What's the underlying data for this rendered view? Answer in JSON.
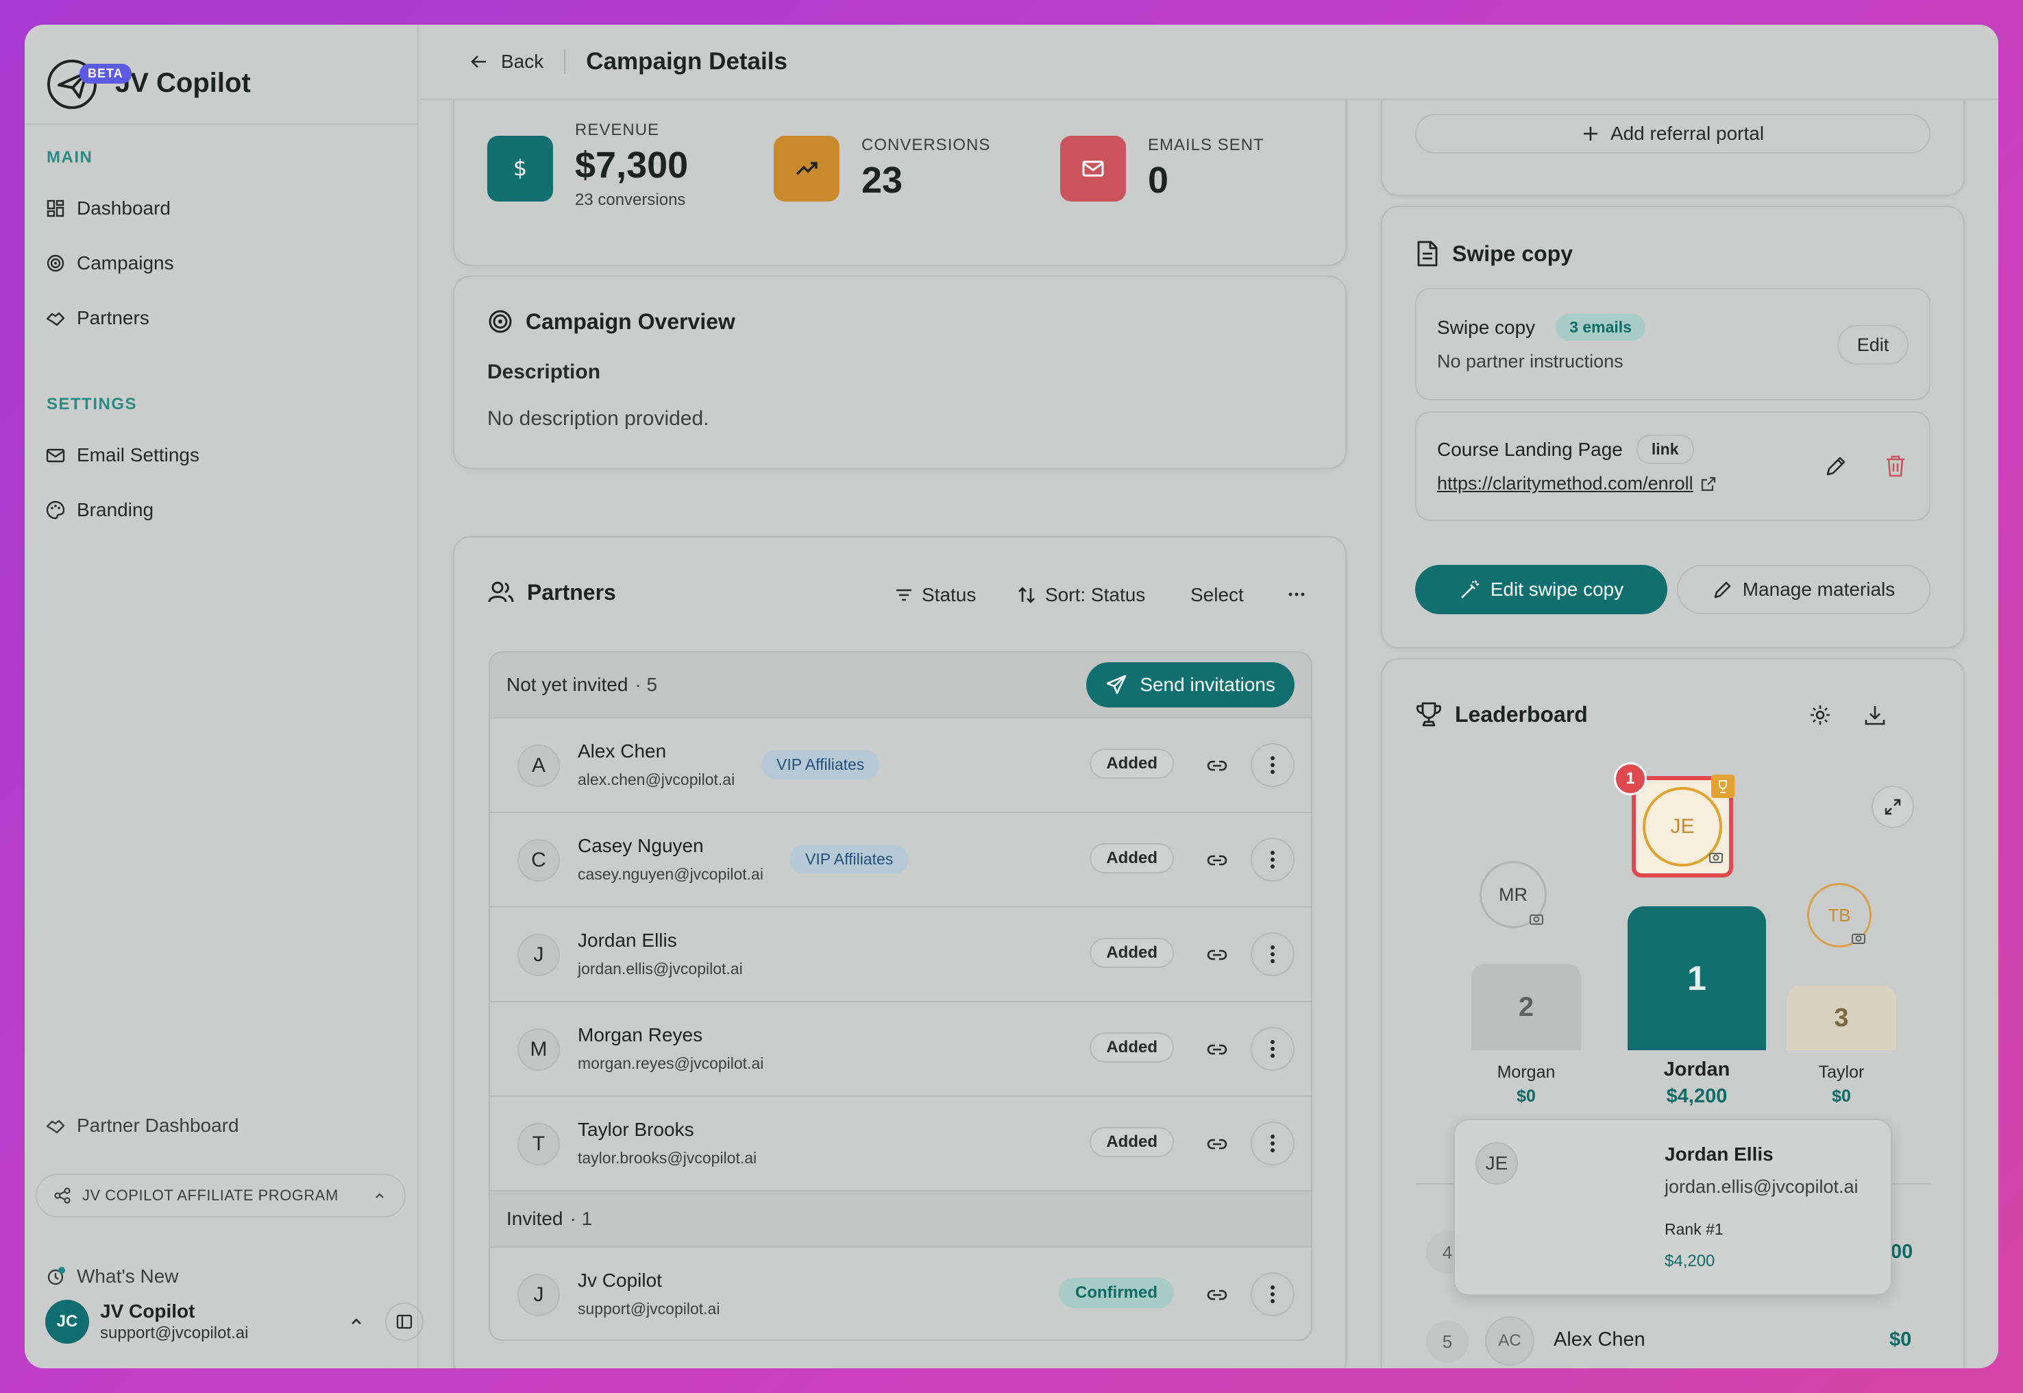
{
  "app": {
    "name": "JV Copilot",
    "beta_label": "BETA"
  },
  "sidebar": {
    "main_label": "MAIN",
    "main_items": [
      {
        "label": "Dashboard",
        "icon": "dashboard-icon"
      },
      {
        "label": "Campaigns",
        "icon": "target-icon"
      },
      {
        "label": "Partners",
        "icon": "handshake-icon"
      }
    ],
    "settings_label": "SETTINGS",
    "settings_items": [
      {
        "label": "Email Settings",
        "icon": "mail-icon"
      },
      {
        "label": "Branding",
        "icon": "palette-icon"
      }
    ],
    "partner_dashboard": "Partner Dashboard",
    "program": "JV COPILOT AFFILIATE PROGRAM",
    "whats_new": "What's New",
    "user": {
      "initials": "JC",
      "name": "JV Copilot",
      "email": "support@jvcopilot.ai"
    }
  },
  "header": {
    "back_label": "Back",
    "title": "Campaign Details"
  },
  "stats": [
    {
      "label": "REVENUE",
      "value": "$7,300",
      "sub": "23 conversions",
      "icon": "dollar-icon",
      "color": "#11706f"
    },
    {
      "label": "CONVERSIONS",
      "value": "23",
      "icon": "trending-up-icon",
      "color": "#c98a2e"
    },
    {
      "label": "EMAILS SENT",
      "value": "0",
      "icon": "mail-icon",
      "color": "#c9545c"
    }
  ],
  "overview": {
    "title": "Campaign Overview",
    "desc_label": "Description",
    "desc_text": "No description provided."
  },
  "partners": {
    "title": "Partners",
    "status_btn": "Status",
    "sort_btn": "Sort: Status",
    "select_btn": "Select",
    "group1": {
      "label": "Not yet invited",
      "count": "· 5",
      "action": "Send invitations"
    },
    "rows": [
      {
        "initial": "A",
        "name": "Alex Chen",
        "email": "alex.chen@jvcopilot.ai",
        "tag": "VIP Affiliates",
        "status": "Added"
      },
      {
        "initial": "C",
        "name": "Casey Nguyen",
        "email": "casey.nguyen@jvcopilot.ai",
        "tag": "VIP Affiliates",
        "status": "Added"
      },
      {
        "initial": "J",
        "name": "Jordan Ellis",
        "email": "jordan.ellis@jvcopilot.ai",
        "tag": "",
        "status": "Added"
      },
      {
        "initial": "M",
        "name": "Morgan Reyes",
        "email": "morgan.reyes@jvcopilot.ai",
        "tag": "",
        "status": "Added"
      },
      {
        "initial": "T",
        "name": "Taylor Brooks",
        "email": "taylor.brooks@jvcopilot.ai",
        "tag": "",
        "status": "Added"
      }
    ],
    "group2": {
      "label": "Invited",
      "count": "· 1"
    },
    "invited_row": {
      "initial": "J",
      "name": "Jv Copilot",
      "email": "support@jvcopilot.ai",
      "status": "Confirmed"
    }
  },
  "referral": {
    "add_label": "Add referral portal"
  },
  "swipe": {
    "title": "Swipe copy",
    "box1": {
      "title": "Swipe copy",
      "badge": "3 emails",
      "sub": "No partner instructions",
      "edit": "Edit"
    },
    "box2": {
      "title": "Course Landing Page",
      "badge": "link",
      "url": "https://claritymethod.com/enroll"
    },
    "edit_btn": "Edit swipe copy",
    "manage_btn": "Manage materials"
  },
  "leaderboard": {
    "title": "Leaderboard",
    "notification_count": "1",
    "first": {
      "initials": "JE",
      "rank": "1",
      "name": "Jordan",
      "amount": "$4,200"
    },
    "second": {
      "initials": "MR",
      "rank": "2",
      "name": "Morgan",
      "amount": "$0"
    },
    "third": {
      "initials": "TB",
      "rank": "3",
      "name": "Taylor",
      "amount": "$0"
    },
    "popup": {
      "initials": "JE",
      "name": "Jordan Ellis",
      "email": "jordan.ellis@jvcopilot.ai",
      "rank": "Rank #1",
      "amount": "$4,200"
    },
    "row4": {
      "rank": "4",
      "amount_tail": "00"
    },
    "row5": {
      "rank": "5",
      "initials": "AC",
      "name": "Alex Chen",
      "amount": "$0"
    }
  }
}
